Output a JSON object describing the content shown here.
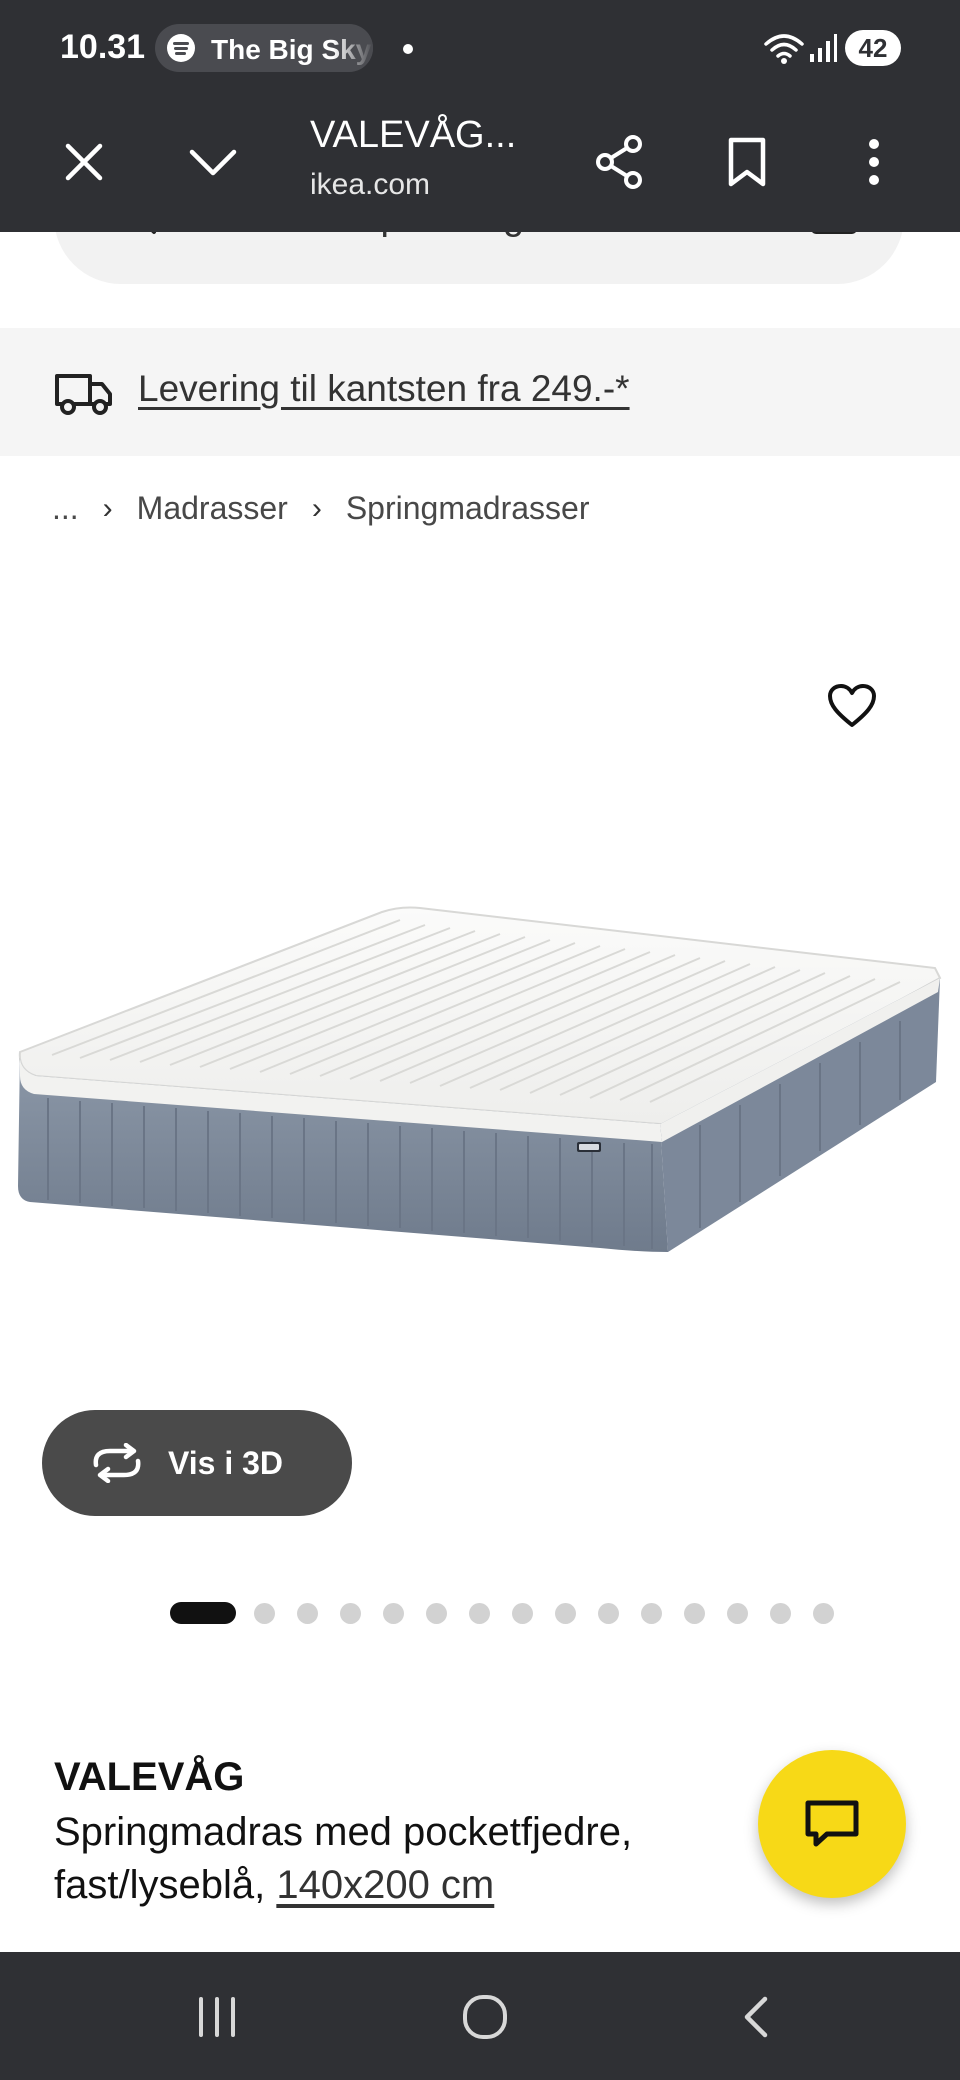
{
  "status_bar": {
    "time": "10.31",
    "media_text": "The Big Sky",
    "battery": "42",
    "icons": [
      "spotify-icon",
      "wifi-icon",
      "signal-icon",
      "battery-icon"
    ]
  },
  "browser": {
    "title": "VALEVÅG...",
    "domain": "ikea.com",
    "icons": [
      "close-icon",
      "chevron-down-icon",
      "share-icon",
      "bookmark-icon",
      "more-vertical-icon"
    ]
  },
  "search": {
    "placeholder": "Hvad er du på udkig efter?"
  },
  "delivery": {
    "text": "Levering til kantsten fra 249.-*"
  },
  "breadcrumb": {
    "items": [
      "...",
      "Madrasser",
      "Springmadrasser"
    ]
  },
  "gallery": {
    "view_3d_label": "Vis i 3D",
    "total_images": 15,
    "active_index": 0
  },
  "product": {
    "name": "VALEVÅG",
    "description": "Springmadras med pocketfjedre, fast/lyseblå,",
    "size": "140x200 cm"
  },
  "colors": {
    "bar_dark": "#2f3034",
    "fab_yellow": "#f7d917",
    "mattress_top": "#f4f4f2",
    "mattress_side": "#7d8a9c"
  }
}
